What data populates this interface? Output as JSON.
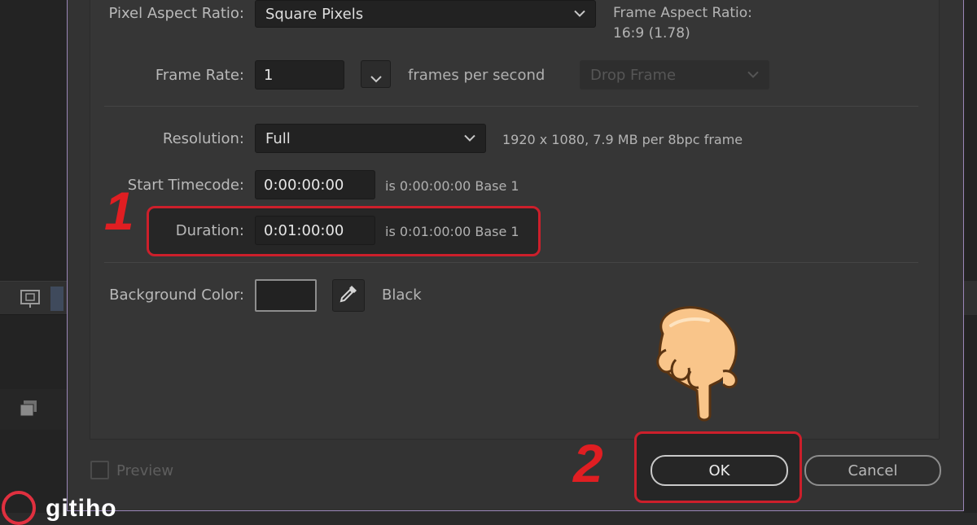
{
  "dialog": {
    "pixel_aspect_ratio": {
      "label": "Pixel Aspect Ratio:",
      "value": "Square Pixels"
    },
    "frame_aspect_ratio": {
      "label": "Frame Aspect Ratio:",
      "value": "16:9 (1.78)"
    },
    "frame_rate": {
      "label": "Frame Rate:",
      "value": "1",
      "units": "frames per second",
      "drop_frame": "Drop Frame"
    },
    "resolution": {
      "label": "Resolution:",
      "value": "Full",
      "info": "1920 x 1080, 7.9 MB per 8bpc frame"
    },
    "start_timecode": {
      "label": "Start Timecode:",
      "value": "0:00:00:00",
      "info": "is 0:00:00:00  Base 1"
    },
    "duration": {
      "label": "Duration:",
      "value": "0:01:00:00",
      "info": "is 0:01:00:00  Base 1"
    },
    "background_color": {
      "label": "Background Color:",
      "name": "Black",
      "swatch": "#222222"
    },
    "preview_label": "Preview",
    "ok_label": "OK",
    "cancel_label": "Cancel"
  },
  "annotations": {
    "step1": "1",
    "step2": "2",
    "highlight_color": "#cc1f2b"
  },
  "logo": {
    "text": "gitiho"
  }
}
